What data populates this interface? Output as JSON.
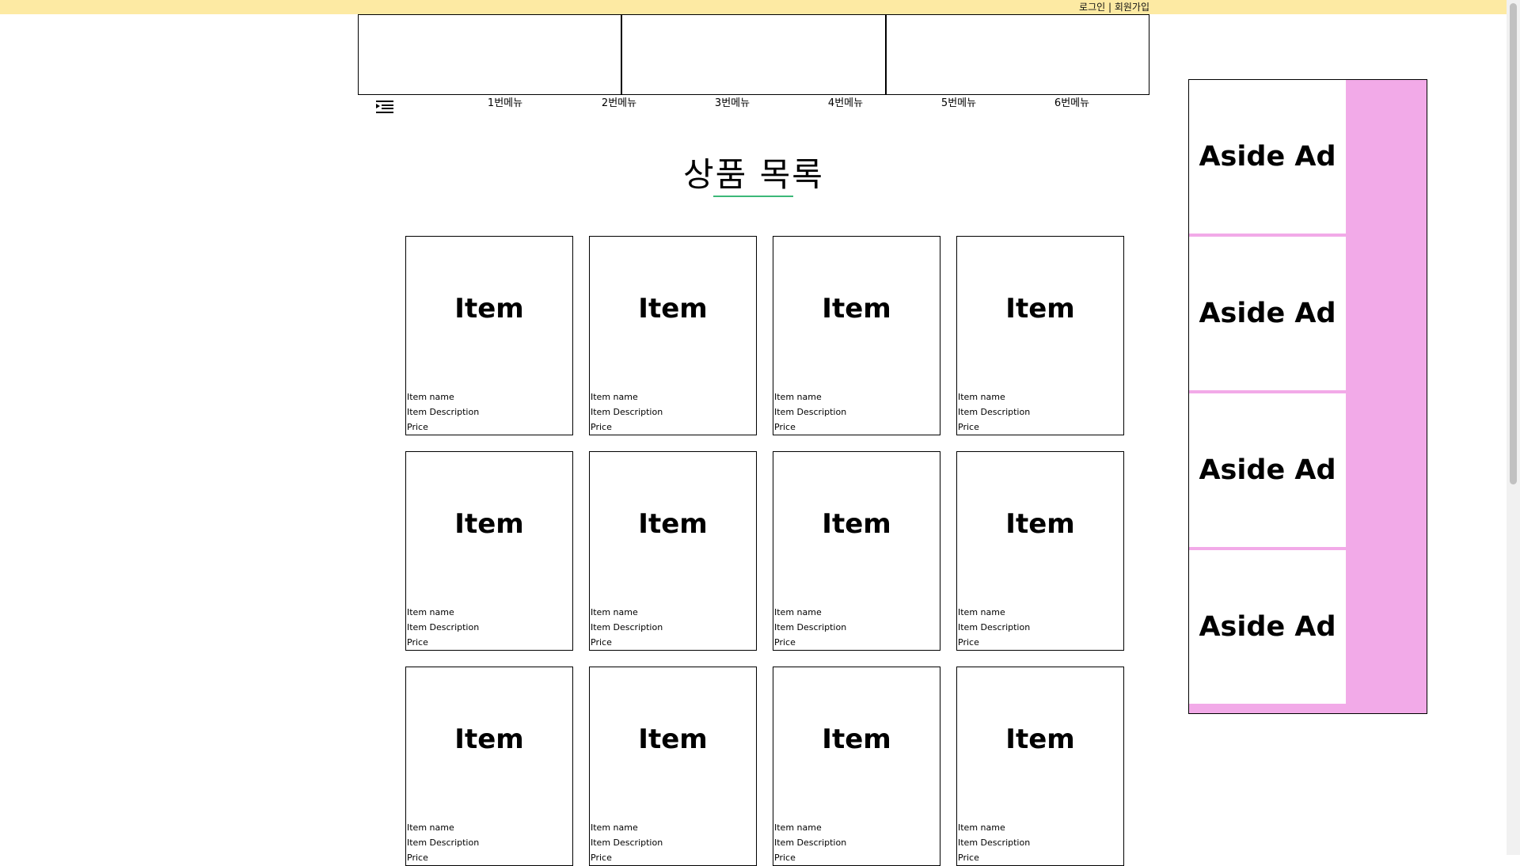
{
  "header": {
    "auth_text": "로그인 | 회원가입",
    "login_label": "로그인",
    "separator": " | ",
    "signup_label": "회원가입",
    "bg_color": "#fdeaa3"
  },
  "nav": {
    "menu_icon": "menu-indent-icon",
    "items": [
      "1번메뉴",
      "2번메뉴",
      "3번메뉴",
      "4번메뉴",
      "5번메뉴",
      "6번메뉴"
    ]
  },
  "main": {
    "title": "상품 목록",
    "underline_color": "#3cb878",
    "cards": [
      {
        "label": "Item",
        "name": "Item name",
        "description": "Item Description",
        "price": "Price"
      },
      {
        "label": "Item",
        "name": "Item name",
        "description": "Item Description",
        "price": "Price"
      },
      {
        "label": "Item",
        "name": "Item name",
        "description": "Item Description",
        "price": "Price"
      },
      {
        "label": "Item",
        "name": "Item name",
        "description": "Item Description",
        "price": "Price"
      },
      {
        "label": "Item",
        "name": "Item name",
        "description": "Item Description",
        "price": "Price"
      },
      {
        "label": "Item",
        "name": "Item name",
        "description": "Item Description",
        "price": "Price"
      },
      {
        "label": "Item",
        "name": "Item name",
        "description": "Item Description",
        "price": "Price"
      },
      {
        "label": "Item",
        "name": "Item name",
        "description": "Item Description",
        "price": "Price"
      },
      {
        "label": "Item",
        "name": "Item name",
        "description": "Item Description",
        "price": "Price"
      },
      {
        "label": "Item",
        "name": "Item name",
        "description": "Item Description",
        "price": "Price"
      },
      {
        "label": "Item",
        "name": "Item name",
        "description": "Item Description",
        "price": "Price"
      },
      {
        "label": "Item",
        "name": "Item name",
        "description": "Item Description",
        "price": "Price"
      }
    ]
  },
  "aside": {
    "bg_color": "#f2aae8",
    "ads": [
      "Aside Ad",
      "Aside Ad",
      "Aside Ad",
      "Aside Ad"
    ]
  }
}
